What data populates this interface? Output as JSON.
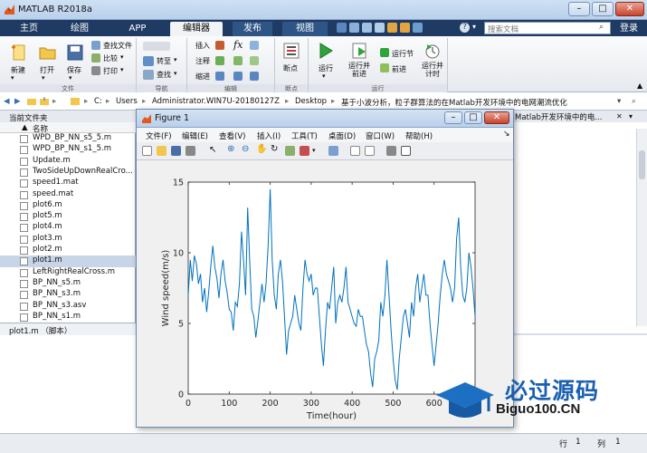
{
  "window": {
    "title": "MATLAB R2018a",
    "search_placeholder": "搜索文档",
    "login": "登录"
  },
  "tabs": [
    "主页",
    "绘图",
    "APP",
    "编辑器",
    "发布",
    "视图"
  ],
  "ribbon": {
    "new": "新建",
    "open": "打开",
    "save": "保存",
    "find_files": "查找文件",
    "compare": "比较",
    "print": "打印",
    "group_file": "文件",
    "goto": "转至",
    "find": "查找",
    "group_nav": "导航",
    "insert": "插入",
    "comment": "注释",
    "indent": "缩进",
    "fx": "fx",
    "group_edit": "编辑",
    "breakpoints": "断点",
    "group_breakpoints": "断点",
    "run": "运行",
    "run_advance": "运行并\n前进",
    "run_section": "运行节",
    "advance": "前进",
    "run_time": "运行并\n计时",
    "group_run": "运行"
  },
  "address": {
    "path": [
      "C:",
      "Users",
      "Administrator.WIN7U-20180127Z",
      "Desktop",
      "基于小波分析，粒子群算法的在Matlab开发环境中的电网潮流优化"
    ]
  },
  "left_panel": {
    "title": "当前文件夹",
    "col_name": "名称",
    "files": [
      {
        "name": "WPD_BP_NN_s5_5.m",
        "selected": false
      },
      {
        "name": "WPD_BP_NN_s1_5.m",
        "selected": false
      },
      {
        "name": "Update.m",
        "selected": false
      },
      {
        "name": "TwoSideUpDownRealCro...",
        "selected": false
      },
      {
        "name": "speed1.mat",
        "selected": false
      },
      {
        "name": "speed.mat",
        "selected": false
      },
      {
        "name": "plot6.m",
        "selected": false
      },
      {
        "name": "plot5.m",
        "selected": false
      },
      {
        "name": "plot4.m",
        "selected": false
      },
      {
        "name": "plot3.m",
        "selected": false
      },
      {
        "name": "plot2.m",
        "selected": false
      },
      {
        "name": "plot1.m",
        "selected": true
      },
      {
        "name": "LeftRightRealCross.m",
        "selected": false
      },
      {
        "name": "BP_NN_s5.m",
        "selected": false
      },
      {
        "name": "BP_NN_s3.m",
        "selected": false
      },
      {
        "name": "BP_NN_s3.asv",
        "selected": false
      },
      {
        "name": "BP_NN_s1.m",
        "selected": false
      }
    ],
    "details": "plot1.m （脚本）"
  },
  "right_panel": {
    "tab_title": "Matlab开发环境中的电..."
  },
  "figure": {
    "title": "Figure 1",
    "menu": [
      "文件(F)",
      "编辑(E)",
      "查看(V)",
      "插入(I)",
      "工具(T)",
      "桌面(D)",
      "窗口(W)",
      "帮助(H)"
    ]
  },
  "status": {
    "row_label": "行",
    "row_value": "1",
    "col_label": "列",
    "col_value": "1"
  },
  "watermark": {
    "text1": "必过源码",
    "text2": "Biguo100.CN"
  },
  "chart_data": {
    "type": "line",
    "xlabel": "Time(hour)",
    "ylabel": "Wind speed(m/s)",
    "xlim": [
      0,
      700
    ],
    "ylim": [
      0,
      15
    ],
    "xticks": [
      0,
      100,
      200,
      300,
      400,
      500,
      600
    ],
    "yticks": [
      0,
      5,
      10,
      15
    ],
    "color": "#0072bd",
    "series": [
      {
        "x": [
          0,
          5,
          10,
          15,
          20,
          25,
          30,
          35,
          40,
          45,
          50,
          55,
          60,
          65,
          70,
          75,
          80,
          85,
          90,
          95,
          100,
          105,
          110,
          115,
          120,
          125,
          130,
          135,
          140,
          145,
          150,
          155,
          160,
          165,
          170,
          175,
          180,
          185,
          190,
          195,
          200,
          205,
          210,
          215,
          220,
          225,
          230,
          235,
          240,
          245,
          250,
          255,
          260,
          265,
          270,
          275,
          280,
          285,
          290,
          295,
          300,
          305,
          310,
          315,
          320,
          325,
          330,
          335,
          340,
          345,
          350,
          355,
          360,
          365,
          370,
          375,
          380,
          385,
          390,
          395,
          400,
          405,
          410,
          415,
          420,
          425,
          430,
          435,
          440,
          445,
          450,
          455,
          460,
          465,
          470,
          475,
          480,
          485,
          490,
          495,
          500,
          505,
          510,
          515,
          520,
          525,
          530,
          535,
          540,
          545,
          550,
          555,
          560,
          565,
          570,
          575,
          580,
          585,
          590,
          595,
          600,
          605,
          610,
          615,
          620,
          625,
          630,
          635,
          640,
          645,
          650,
          655,
          660,
          665,
          670,
          675,
          680,
          685,
          690,
          695,
          700
        ],
        "values": [
          7.0,
          9.5,
          8.0,
          9.8,
          9.2,
          7.8,
          8.5,
          6.5,
          7.5,
          5.8,
          7.2,
          9.0,
          10.5,
          9.0,
          8.2,
          6.8,
          8.5,
          9.5,
          8.0,
          7.2,
          6.0,
          5.8,
          4.5,
          6.5,
          6.2,
          7.8,
          11.5,
          9.5,
          7.0,
          13.2,
          9.5,
          6.0,
          5.5,
          4.0,
          5.2,
          6.5,
          7.8,
          6.5,
          7.8,
          10.5,
          14.5,
          9.5,
          7.0,
          6.0,
          8.5,
          9.5,
          8.0,
          5.5,
          2.8,
          4.5,
          5.0,
          5.5,
          7.0,
          6.0,
          5.0,
          4.5,
          7.5,
          9.5,
          8.5,
          8.0,
          8.5,
          7.0,
          7.5,
          7.5,
          5.5,
          3.5,
          2.0,
          4.5,
          6.5,
          6.0,
          7.5,
          9.0,
          5.0,
          6.5,
          7.0,
          6.5,
          7.5,
          9.0,
          6.5,
          6.0,
          5.5,
          5.0,
          4.8,
          6.0,
          5.5,
          5.5,
          4.5,
          3.5,
          3.0,
          1.5,
          0.5,
          2.5,
          3.0,
          3.8,
          6.5,
          5.5,
          7.0,
          9.5,
          7.0,
          4.5,
          2.5,
          1.0,
          0.3,
          2.5,
          4.0,
          5.5,
          6.0,
          5.0,
          4.0,
          6.5,
          5.5,
          7.5,
          8.5,
          6.5,
          7.5,
          8.5,
          7.0,
          7.0,
          5.0,
          3.5,
          2.0,
          3.5,
          5.0,
          7.0,
          8.5,
          9.5,
          8.5,
          8.0,
          7.5,
          6.5,
          7.5,
          11.0,
          12.5,
          9.0,
          7.0,
          6.5,
          7.5,
          10.0,
          9.0,
          7.5,
          5.5
        ]
      }
    ]
  }
}
